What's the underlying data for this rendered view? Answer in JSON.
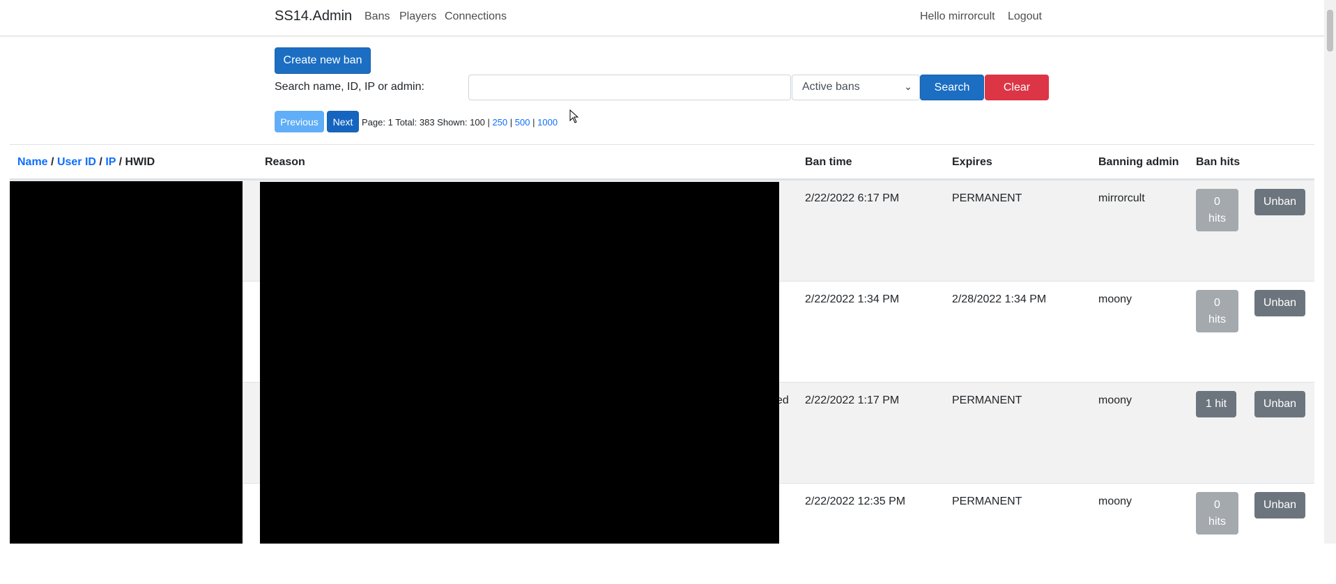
{
  "nav": {
    "brand": "SS14.Admin",
    "links": [
      "Bans",
      "Players",
      "Connections"
    ],
    "greeting": "Hello mirrorcult",
    "logout": "Logout"
  },
  "toolbar": {
    "create_label": "Create new ban",
    "search_label": "Search name, ID, IP or admin:",
    "search_value": "",
    "filter_selected": "Active bans",
    "search_button": "Search",
    "clear_button": "Clear"
  },
  "pager": {
    "previous": "Previous",
    "next": "Next",
    "summary": "Page: 1 Total: 383 Shown: 100 |",
    "sizes": [
      "250",
      "500",
      "1000"
    ]
  },
  "table": {
    "headers": {
      "name": "Name",
      "user_id": "User ID",
      "ip": "IP",
      "hwid": "HWID",
      "sep": "/",
      "reason": "Reason",
      "ban_time": "Ban time",
      "expires": "Expires",
      "admin": "Banning admin",
      "hits": "Ban hits"
    },
    "rows": [
      {
        "reason_tail": "",
        "ban_time": "2/22/2022 6:17 PM",
        "expires": "PERMANENT",
        "admin": "mirrorcult",
        "hits_line1": "0",
        "hits_line2": "hits",
        "unban": "Unban"
      },
      {
        "reason_tail": "",
        "ban_time": "2/22/2022 1:34 PM",
        "expires": "2/28/2022 1:34 PM",
        "admin": "moony",
        "hits_line1": "0",
        "hits_line2": "hits",
        "unban": "Unban"
      },
      {
        "reason_tail": "ed",
        "ban_time": "2/22/2022 1:17 PM",
        "expires": "PERMANENT",
        "admin": "moony",
        "hits_line1": "1 hit",
        "hits_line2": "",
        "unban": "Unban"
      },
      {
        "reason_tail": "",
        "ban_time": "2/22/2022 12:35 PM",
        "expires": "PERMANENT",
        "admin": "moony",
        "hits_line1": "0",
        "hits_line2": "hits",
        "unban": "Unban"
      }
    ]
  }
}
